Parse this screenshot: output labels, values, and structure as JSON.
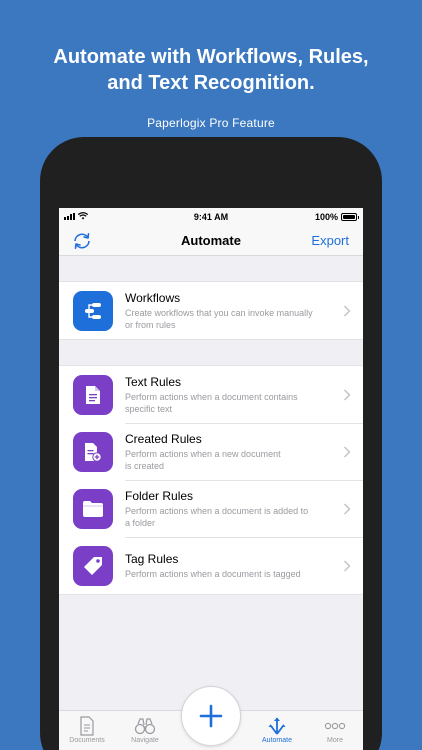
{
  "promo": {
    "headline_line1": "Automate with Workflows, Rules,",
    "headline_line2": "and Text Recognition.",
    "subhead": "Paperlogix Pro Feature"
  },
  "status_bar": {
    "time": "9:41 AM",
    "battery": "100%"
  },
  "navbar": {
    "title": "Automate",
    "export_label": "Export",
    "left_icon": "refresh-icon"
  },
  "sections": [
    {
      "items": [
        {
          "title": "Workflows",
          "subtitle_line1": "Create workflows that you can invoke manually",
          "subtitle_line2": "or from rules",
          "icon": "workflow-icon",
          "color": "#1e6fd9"
        }
      ]
    },
    {
      "items": [
        {
          "title": "Text Rules",
          "subtitle_line1": "Perform actions when a document contains",
          "subtitle_line2": "specific text",
          "icon": "text-document-icon",
          "color": "#7a3fc6"
        },
        {
          "title": "Created Rules",
          "subtitle_line1": "Perform actions when a new document",
          "subtitle_line2": "is created",
          "icon": "new-document-icon",
          "color": "#7a3fc6"
        },
        {
          "title": "Folder Rules",
          "subtitle_line1": "Perform actions when a document is added to",
          "subtitle_line2": "a folder",
          "icon": "folder-icon",
          "color": "#7a3fc6"
        },
        {
          "title": "Tag Rules",
          "subtitle_line1": "Perform actions when a document is tagged",
          "subtitle_line2": "",
          "icon": "tag-icon",
          "color": "#7a3fc6"
        }
      ]
    }
  ],
  "tabbar": {
    "tabs": [
      {
        "label": "Documents",
        "icon": "documents-icon",
        "active": false
      },
      {
        "label": "Navigate",
        "icon": "binoculars-icon",
        "active": false
      },
      {
        "label": "Automate",
        "icon": "automate-icon",
        "active": true
      },
      {
        "label": "More",
        "icon": "more-icon",
        "active": false
      }
    ],
    "center_button_icon": "plus-icon"
  },
  "colors": {
    "background": "#3b78c0",
    "accent": "#1e6fd9",
    "rule_icon": "#7a3fc6"
  }
}
